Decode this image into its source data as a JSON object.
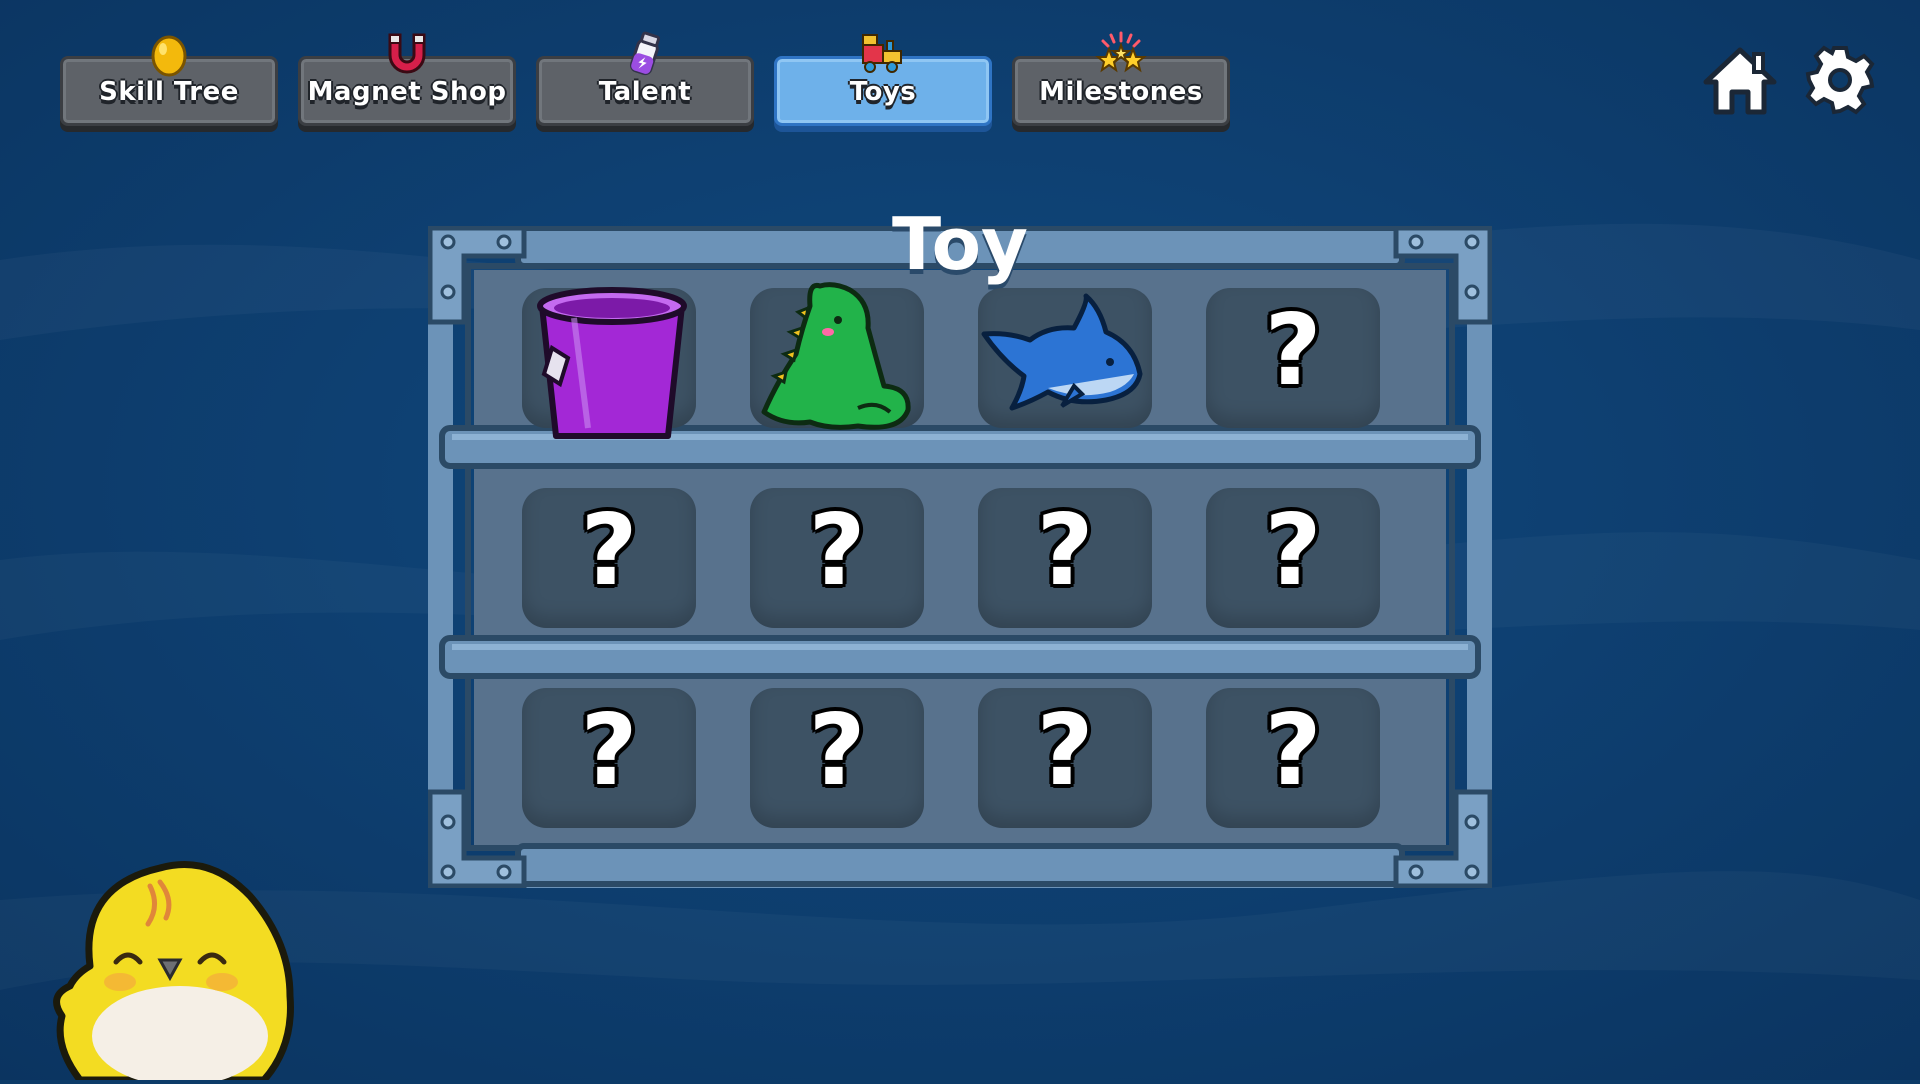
{
  "tabs": [
    {
      "label": "Skill Tree",
      "icon": "egg-icon",
      "active": false
    },
    {
      "label": "Magnet Shop",
      "icon": "magnet-icon",
      "active": false
    },
    {
      "label": "Talent",
      "icon": "potion-icon",
      "active": false
    },
    {
      "label": "Toys",
      "icon": "toy-train-icon",
      "active": true
    },
    {
      "label": "Milestones",
      "icon": "stars-icon",
      "active": false
    }
  ],
  "header_icons": {
    "home": "home-icon",
    "settings": "gear-icon"
  },
  "shelf": {
    "title": "Toy",
    "unknown_symbol": "?",
    "slots": [
      {
        "toy": "purple-bucket"
      },
      {
        "toy": "green-dinosaur"
      },
      {
        "toy": "blue-shark"
      },
      {
        "toy": "unknown"
      },
      {
        "toy": "unknown"
      },
      {
        "toy": "unknown"
      },
      {
        "toy": "unknown"
      },
      {
        "toy": "unknown"
      },
      {
        "toy": "unknown"
      },
      {
        "toy": "unknown"
      },
      {
        "toy": "unknown"
      },
      {
        "toy": "unknown"
      }
    ]
  },
  "mascot": "yellow-chick",
  "colors": {
    "background": "#0d3b68",
    "active_tab": "#6eb1ea",
    "inactive_tab": "#5e6268",
    "shelf_wood": "#6c93b8",
    "slot": "#3d5264"
  }
}
